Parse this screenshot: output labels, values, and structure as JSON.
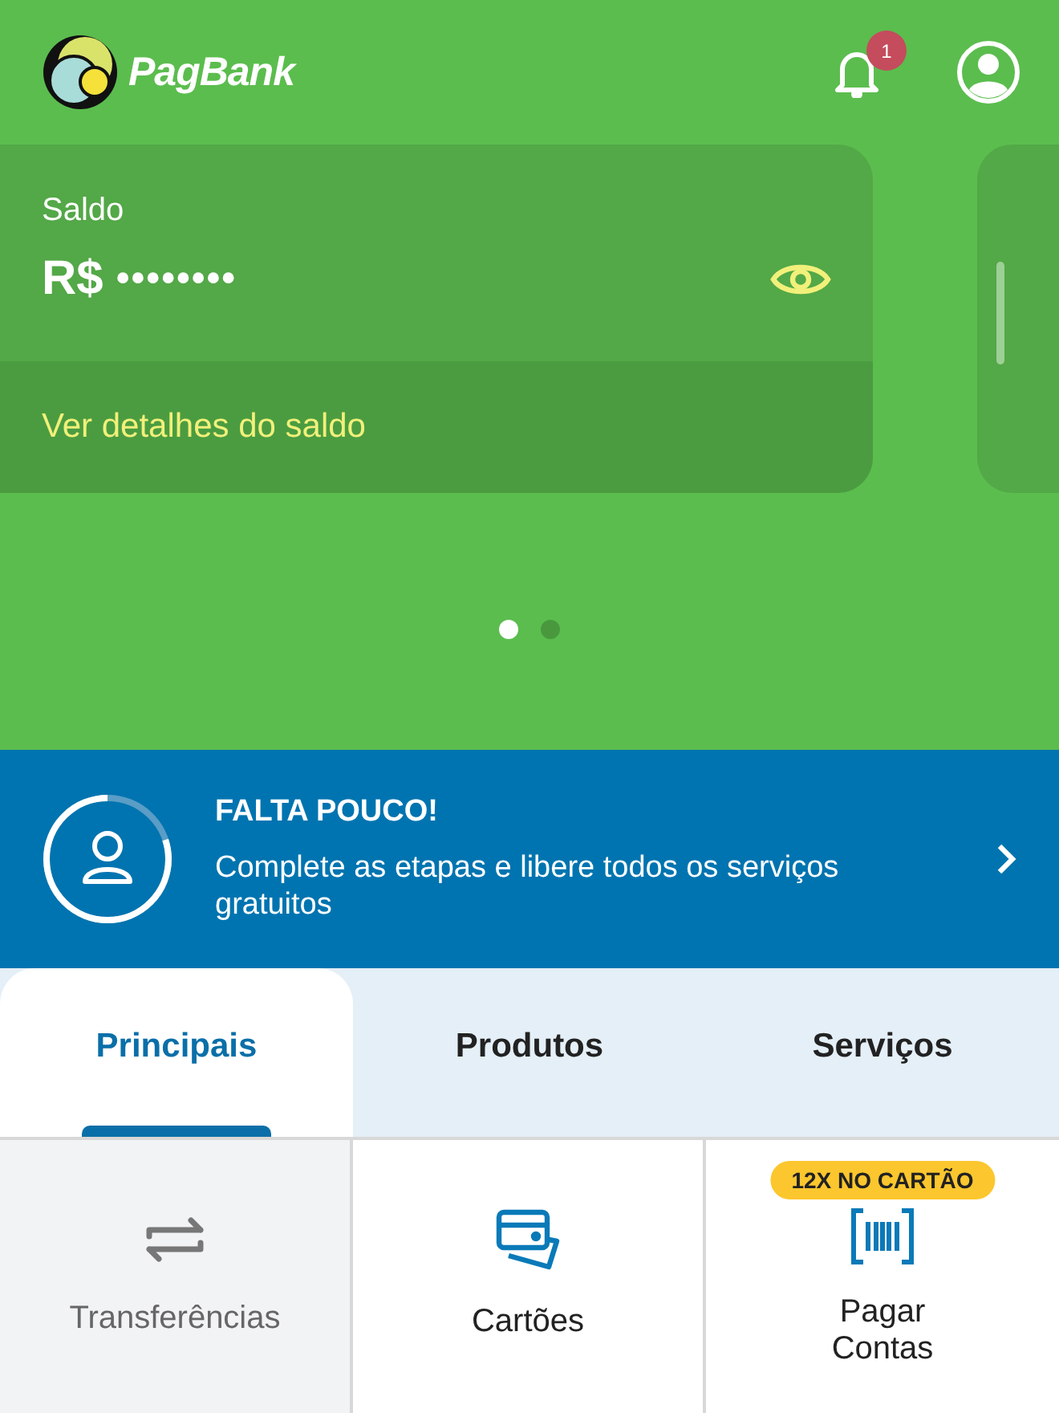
{
  "header": {
    "brand": "PagBank",
    "notifications": {
      "count": "1"
    }
  },
  "balance_card": {
    "label": "Saldo",
    "currency": "R$",
    "masked_value": "••••••••",
    "hidden": true,
    "details_link": "Ver detalhes do saldo"
  },
  "carousel_dots": [
    {
      "selected": true
    },
    {
      "selected": false
    }
  ],
  "onboarding_banner": {
    "title": "FALTA POUCO!",
    "text": "Complete as etapas e libere todos os serviços gratuitos"
  },
  "tabs": [
    {
      "label": "Principais",
      "selected": true
    },
    {
      "label": "Produtos",
      "selected": false
    },
    {
      "label": "Serviços",
      "selected": false
    }
  ],
  "shortcuts": [
    {
      "kind": "transfer",
      "label": "Transferências",
      "disabled": true
    },
    {
      "kind": "cards",
      "label": "Cartões",
      "disabled": false
    },
    {
      "kind": "bills",
      "label": "Pagar Contas",
      "disabled": false,
      "badge": "12X NO CARTÃO"
    }
  ]
}
